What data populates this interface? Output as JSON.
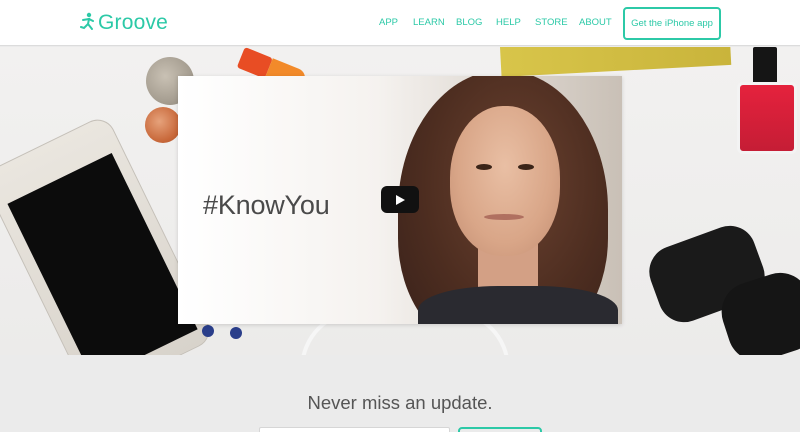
{
  "brand": {
    "name": "Groove",
    "accent": "#2cc9a7"
  },
  "nav": {
    "items": [
      {
        "label": "APP"
      },
      {
        "label": "LEARN"
      },
      {
        "label": "BLOG"
      },
      {
        "label": "HELP"
      },
      {
        "label": "STORE"
      },
      {
        "label": "ABOUT"
      }
    ],
    "cta_label": "Get the iPhone app"
  },
  "hero": {
    "video": {
      "title": "#KnowYou",
      "play_icon": "play-icon"
    }
  },
  "subscribe": {
    "title": "Never miss an update."
  }
}
